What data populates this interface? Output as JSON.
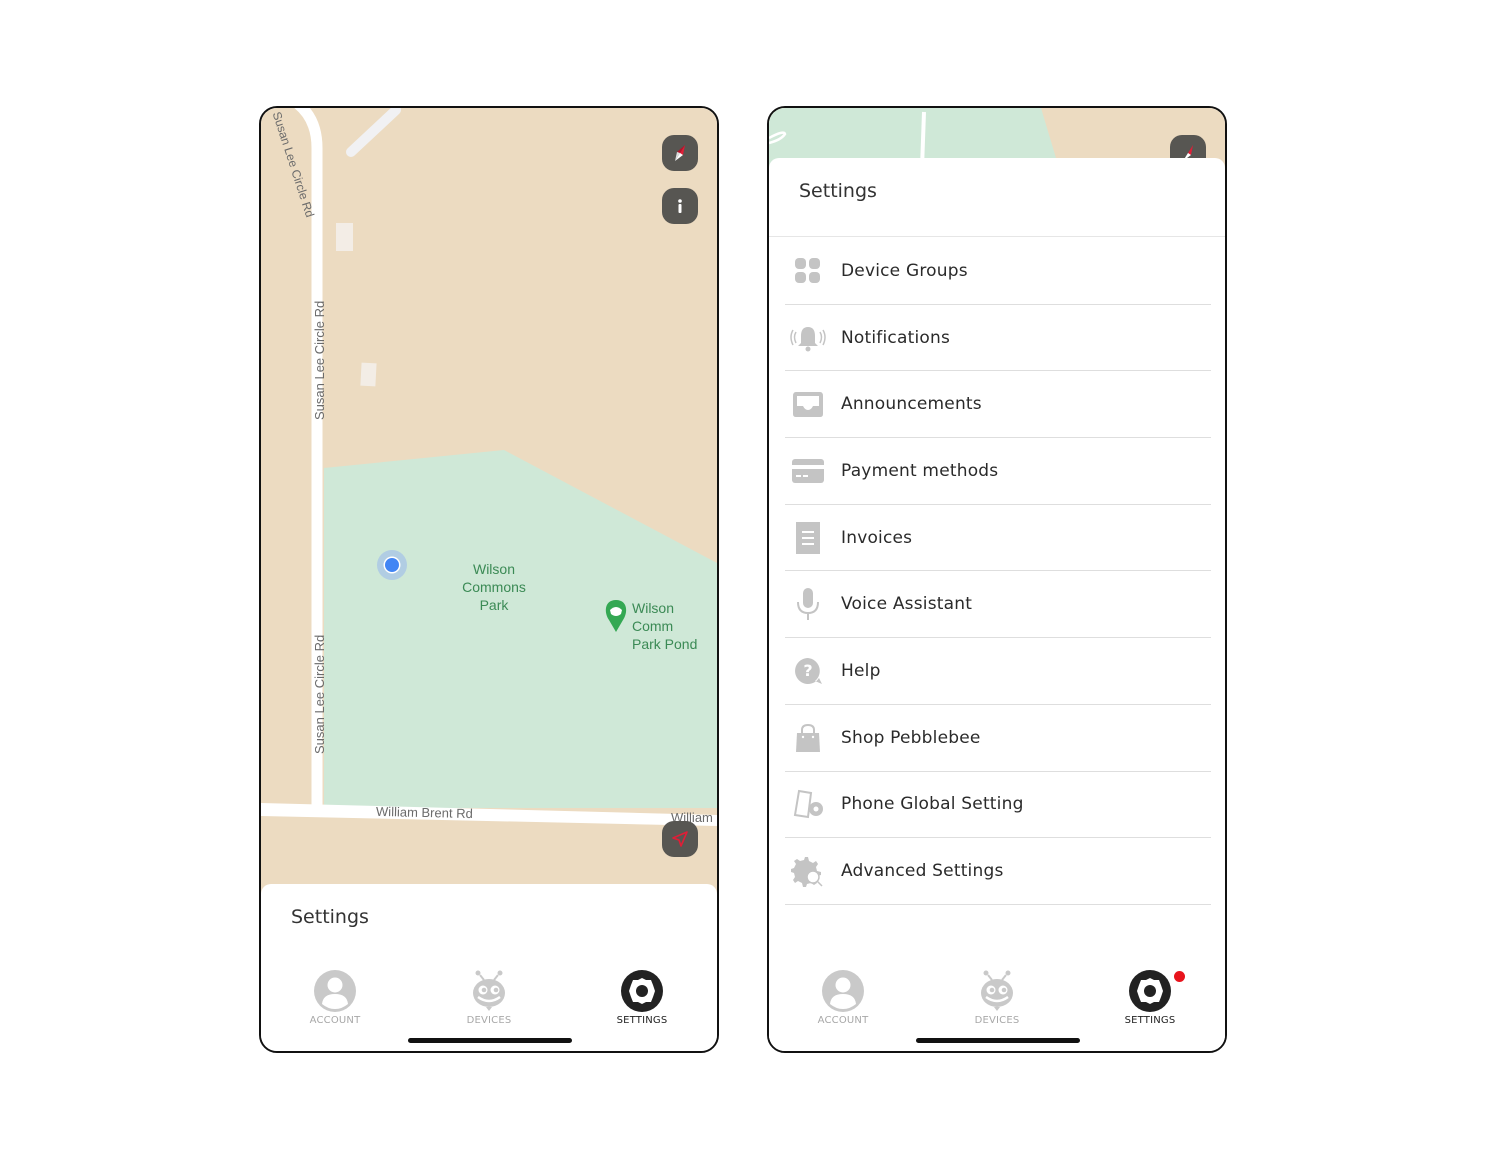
{
  "left_screen": {
    "map": {
      "road_labels": {
        "top_curve": "Susan Lee Circle Rd",
        "vertical_upper": "Susan Lee Circle Rd",
        "vertical_lower": "Susan Lee Circle Rd",
        "horizontal": "William Brent Rd",
        "horizontal_right": "William"
      },
      "park_label": [
        "Wilson",
        "Commons",
        "Park"
      ],
      "poi_label": [
        "Wilson Comm",
        "Park Pond"
      ],
      "colors": {
        "land": "#ecdbc1",
        "park": "#cfe8d7",
        "road": "#ffffff",
        "location_dot": "#4285f4",
        "poi_green": "#34a853"
      },
      "buttons": {
        "compass": "compass-icon",
        "info": "info-icon",
        "locate": "navigation-arrow-icon"
      }
    },
    "sheet": {
      "title": "Settings"
    }
  },
  "right_screen": {
    "sheet": {
      "title": "Settings"
    },
    "menu": [
      {
        "label": "Device Groups",
        "icon": "grid-icon"
      },
      {
        "label": "Notifications",
        "icon": "bell-icon"
      },
      {
        "label": "Announcements",
        "icon": "inbox-icon"
      },
      {
        "label": "Payment methods",
        "icon": "credit-card-icon"
      },
      {
        "label": "Invoices",
        "icon": "receipt-icon"
      },
      {
        "label": "Voice Assistant",
        "icon": "microphone-icon"
      },
      {
        "label": "Help",
        "icon": "help-icon"
      },
      {
        "label": "Shop Pebblebee",
        "icon": "shopping-bag-icon"
      },
      {
        "label": "Phone Global Setting",
        "icon": "phone-gear-icon"
      },
      {
        "label": "Advanced Settings",
        "icon": "gear-search-icon"
      }
    ]
  },
  "tabbar": {
    "tabs": [
      {
        "label": "ACCOUNT",
        "icon": "account-icon",
        "active": false
      },
      {
        "label": "DEVICES",
        "icon": "devices-bee-icon",
        "active": false
      },
      {
        "label": "SETTINGS",
        "icon": "settings-gear-icon",
        "active": true
      }
    ],
    "accent_badge_color": "#e8141c"
  }
}
